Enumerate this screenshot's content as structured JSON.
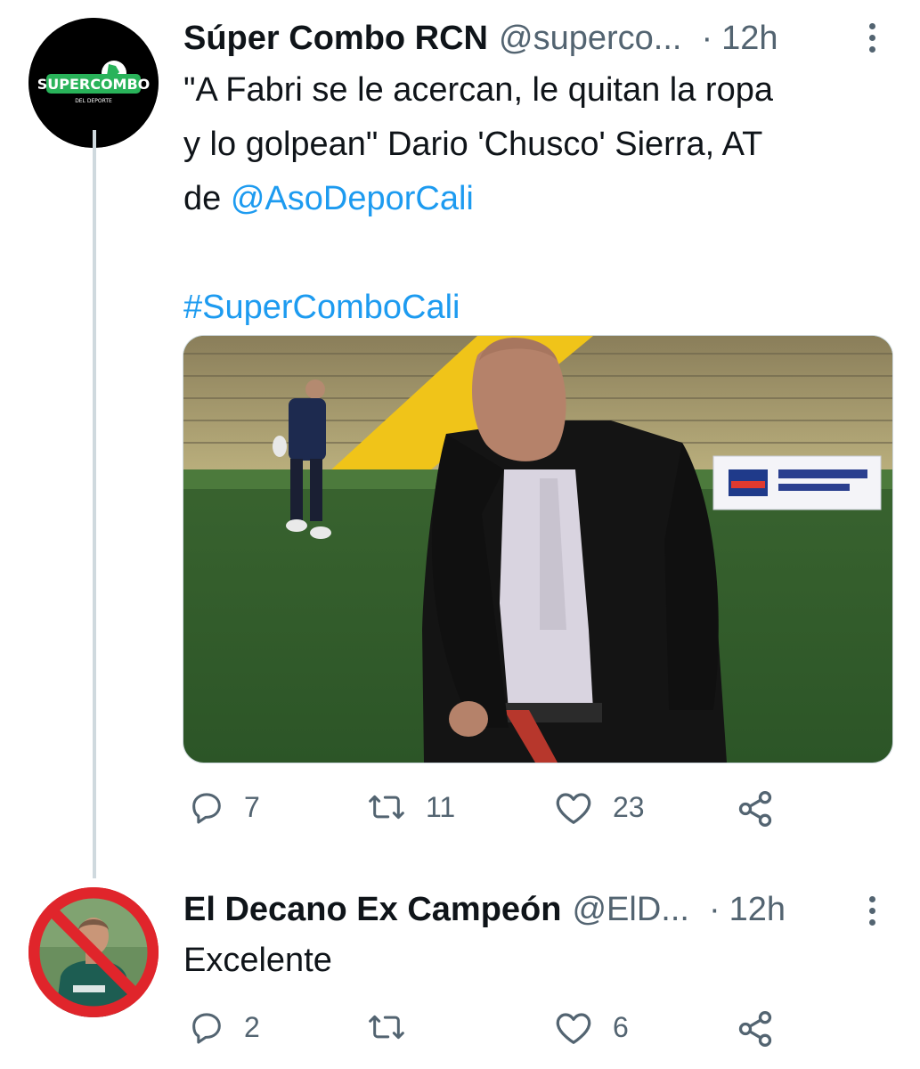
{
  "tweet1": {
    "avatar_logo_text": "SUPERCOMBO",
    "avatar_logo_sub": "DEL DEPORTE",
    "name": "Súper Combo RCN",
    "handle": "@superco...",
    "dot": "·",
    "time": "12h",
    "text_line1": "\"A Fabri se le acercan, le quitan la ropa",
    "text_line2": "y lo golpean\" Dario 'Chusco' Sierra, AT",
    "text_line3_prefix": "de ",
    "mention": "@AsoDeporCali",
    "hashtag": "#SuperComboCali",
    "reply_count": "7",
    "retweet_count": "11",
    "like_count": "23"
  },
  "tweet2": {
    "name": "El Decano Ex Campeón",
    "handle": "@ElD...",
    "dot": "·",
    "time": "12h",
    "text": "Excelente",
    "reply_count": "2",
    "retweet_count": "",
    "like_count": "6"
  },
  "colors": {
    "link": "#1d9bf0",
    "secondary_text": "#536471",
    "thread_line": "#cfd9de",
    "logo_green": "#29b35a",
    "ban_red": "#e0252b"
  },
  "icons": [
    "reply-icon",
    "retweet-icon",
    "like-icon",
    "share-icon",
    "more-options-icon"
  ]
}
